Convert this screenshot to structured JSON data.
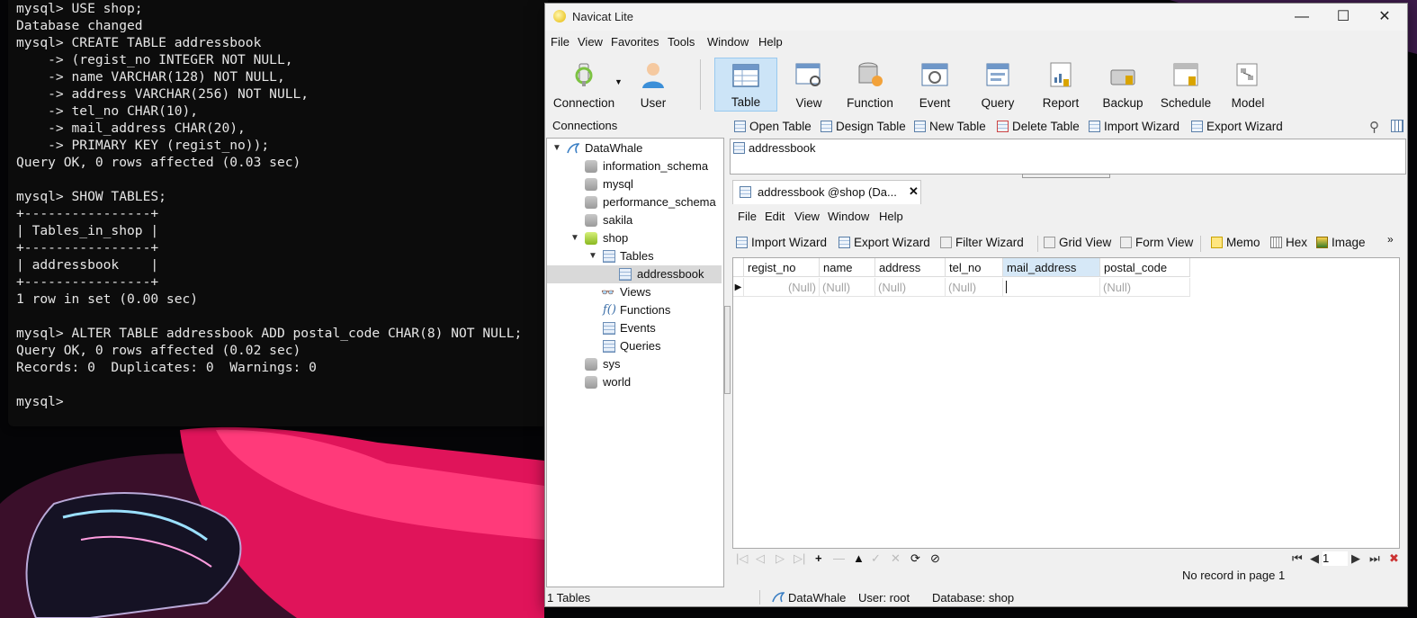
{
  "terminal": {
    "lines": [
      "mysql> USE shop;",
      "Database changed",
      "mysql> CREATE TABLE addressbook",
      "    -> (regist_no INTEGER NOT NULL,",
      "    -> name VARCHAR(128) NOT NULL,",
      "    -> address VARCHAR(256) NOT NULL,",
      "    -> tel_no CHAR(10),",
      "    -> mail_address CHAR(20),",
      "    -> PRIMARY KEY (regist_no));",
      "Query OK, 0 rows affected (0.03 sec)",
      "",
      "mysql> SHOW TABLES;",
      "+----------------+",
      "| Tables_in_shop |",
      "+----------------+",
      "| addressbook    |",
      "+----------------+",
      "1 row in set (0.00 sec)",
      "",
      "mysql> ALTER TABLE addressbook ADD postal_code CHAR(8) NOT NULL;",
      "Query OK, 0 rows affected (0.02 sec)",
      "Records: 0  Duplicates: 0  Warnings: 0",
      "",
      "mysql>"
    ]
  },
  "navicat": {
    "title": "Navicat Lite",
    "menu": [
      "File",
      "View",
      "Favorites",
      "Tools",
      "Window",
      "Help"
    ],
    "toolbar": [
      {
        "label": "Connection",
        "icon": "connection-icon"
      },
      {
        "label": "User",
        "icon": "user-icon"
      },
      {
        "label": "Table",
        "icon": "table-icon"
      },
      {
        "label": "View",
        "icon": "view-icon"
      },
      {
        "label": "Function",
        "icon": "function-icon"
      },
      {
        "label": "Event",
        "icon": "event-icon"
      },
      {
        "label": "Query",
        "icon": "query-icon"
      },
      {
        "label": "Report",
        "icon": "report-icon"
      },
      {
        "label": "Backup",
        "icon": "backup-icon"
      },
      {
        "label": "Schedule",
        "icon": "schedule-icon"
      },
      {
        "label": "Model",
        "icon": "model-icon"
      }
    ],
    "connections_header": "Connections",
    "tree": [
      {
        "label": "DataWhale"
      },
      {
        "label": "information_schema"
      },
      {
        "label": "mysql"
      },
      {
        "label": "performance_schema"
      },
      {
        "label": "sakila"
      },
      {
        "label": "shop"
      },
      {
        "label": "Tables"
      },
      {
        "label": "addressbook"
      },
      {
        "label": "Views"
      },
      {
        "label": "Functions"
      },
      {
        "label": "Events"
      },
      {
        "label": "Queries"
      },
      {
        "label": "sys"
      },
      {
        "label": "world"
      }
    ],
    "object_toolbar": [
      "Open Table",
      "Design Table",
      "New Table",
      "Delete Table",
      "Import Wizard",
      "Export Wizard"
    ],
    "object_list": [
      "addressbook"
    ],
    "tab_label": "addressbook @shop (Da...",
    "inner_menu": [
      "File",
      "Edit",
      "View",
      "Window",
      "Help"
    ],
    "inner_toolbar": [
      "Import Wizard",
      "Export Wizard",
      "Filter Wizard",
      "Grid View",
      "Form View",
      "Memo",
      "Hex",
      "Image"
    ],
    "grid": {
      "columns": [
        "regist_no",
        "name",
        "address",
        "tel_no",
        "mail_address",
        "postal_code"
      ],
      "row": [
        "(Null)",
        "(Null)",
        "(Null)",
        "(Null)",
        "",
        "(Null)"
      ]
    },
    "page_number": "1",
    "page_status": "No record in page 1",
    "status": {
      "tables": "1 Tables",
      "connection": "DataWhale",
      "user": "User: root",
      "database": "Database: shop"
    },
    "colors": {
      "selection": "#cce4f7",
      "accent": "#0078d4"
    }
  }
}
